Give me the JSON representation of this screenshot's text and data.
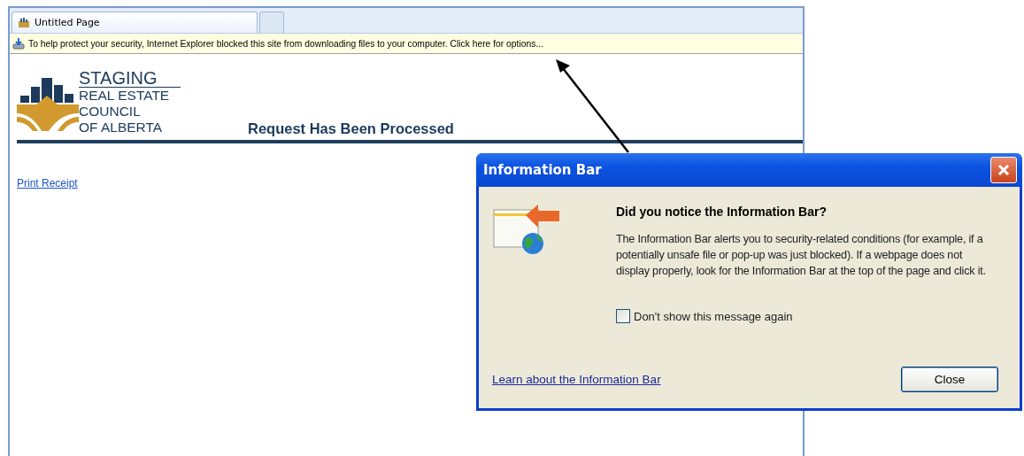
{
  "browser": {
    "tabs": [
      {
        "kind": "page",
        "label": "Untitled Page",
        "selected": true
      },
      {
        "kind": "new",
        "selected": false
      }
    ],
    "information_bar": {
      "text": "To help protect your security, Internet Explorer blocked this site from downloading files to your computer. Click here for options..."
    }
  },
  "page": {
    "logo_lines": [
      "STAGING",
      "REAL ESTATE",
      "COUNCIL",
      "OF ALBERTA"
    ],
    "heading": "Request Has Been Processed",
    "link": "Print Receipt"
  },
  "dialog": {
    "title": "Information Bar",
    "question": "Did you notice the Information Bar?",
    "body": "The Information Bar alerts you to security-related conditions (for example, if a potentially unsafe file or pop-up was just blocked). If a webpage does not display properly, look for the Information Bar at the top of the page and click it.",
    "checkbox": {
      "label": "Don't show this message again",
      "checked": false
    },
    "link": "Learn about the Information Bar",
    "button": "Close"
  }
}
